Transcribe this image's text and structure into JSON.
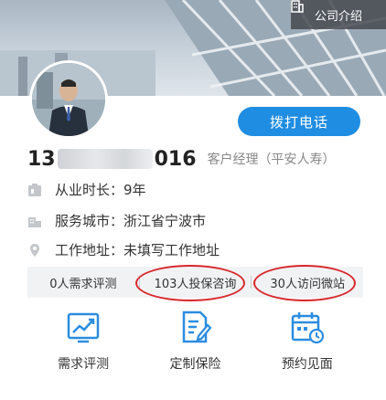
{
  "header": {
    "company_intro_label": "公司介绍"
  },
  "profile": {
    "call_button_label": "拨打电话",
    "phone_prefix": "13",
    "phone_suffix": "016",
    "role": "客户经理（平安人寿）"
  },
  "info": [
    {
      "label": "从业时长：",
      "value": "9年",
      "icon": "experience-icon"
    },
    {
      "label": "服务城市：",
      "value": "浙江省宁波市",
      "icon": "city-icon"
    },
    {
      "label": "工作地址：",
      "value": "未填写工作地址",
      "icon": "location-icon"
    }
  ],
  "stats": [
    {
      "text": "0人需求评测"
    },
    {
      "text": "103人投保咨询"
    },
    {
      "text": "30人访问微站"
    }
  ],
  "features": [
    {
      "label": "需求评测",
      "icon": "chart-icon"
    },
    {
      "label": "定制保险",
      "icon": "document-edit-icon"
    },
    {
      "label": "预约见面",
      "icon": "calendar-icon"
    }
  ],
  "colors": {
    "accent": "#1f8de2",
    "highlight_ring": "#d8262b",
    "icon": "#2b8de0"
  }
}
